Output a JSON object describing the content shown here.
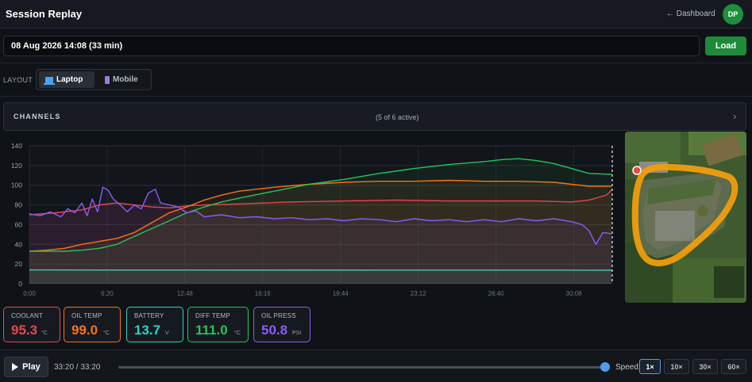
{
  "header": {
    "title": "Session Replay",
    "back_label": "← Dashboard",
    "avatar_initials": "DP"
  },
  "session": {
    "value": "08 Aug 2026 14:08 (33 min)",
    "load_label": "Load"
  },
  "layout": {
    "label": "LAYOUT",
    "options": [
      "Laptop",
      "Mobile"
    ],
    "selected": "Laptop"
  },
  "channels": {
    "title": "CHANNELS",
    "summary": "(5 of 6 active)"
  },
  "chart_data": {
    "type": "line",
    "yticks": [
      "0",
      "20",
      "40",
      "60",
      "80",
      "100",
      "120",
      "140"
    ],
    "xticks": [
      "0:00",
      "6:20",
      "12:48",
      "16:16",
      "19:44",
      "23:12",
      "26:40",
      "30:08"
    ],
    "ylim": [
      0,
      140
    ],
    "xlim_minutes": [
      0,
      33.33
    ],
    "grid": true,
    "series": [
      {
        "name": "COOLANT",
        "color": "#e5484d",
        "points": [
          [
            0,
            70
          ],
          [
            1.5,
            72
          ],
          [
            3,
            75
          ],
          [
            4,
            80
          ],
          [
            5,
            82
          ],
          [
            6,
            80
          ],
          [
            7,
            78
          ],
          [
            8,
            77
          ],
          [
            9,
            79
          ],
          [
            10,
            80
          ],
          [
            12,
            81
          ],
          [
            15,
            83
          ],
          [
            18,
            84
          ],
          [
            21,
            85
          ],
          [
            24,
            84
          ],
          [
            27,
            84
          ],
          [
            29,
            84
          ],
          [
            31,
            83
          ],
          [
            32,
            85
          ],
          [
            33,
            90
          ],
          [
            33.3,
            95.3
          ]
        ]
      },
      {
        "name": "OIL TEMP",
        "color": "#f97316",
        "points": [
          [
            0,
            33
          ],
          [
            1,
            34
          ],
          [
            2,
            36
          ],
          [
            3,
            40
          ],
          [
            4,
            43
          ],
          [
            5,
            46
          ],
          [
            6,
            52
          ],
          [
            7,
            62
          ],
          [
            8,
            72
          ],
          [
            9,
            78
          ],
          [
            10,
            85
          ],
          [
            11,
            90
          ],
          [
            12,
            94
          ],
          [
            14,
            98
          ],
          [
            16,
            101
          ],
          [
            18,
            103
          ],
          [
            20,
            104
          ],
          [
            22,
            104
          ],
          [
            24,
            105
          ],
          [
            26,
            104
          ],
          [
            28,
            104
          ],
          [
            30,
            103
          ],
          [
            31,
            101
          ],
          [
            32,
            99
          ],
          [
            33.3,
            99
          ]
        ]
      },
      {
        "name": "BATTERY",
        "color": "#2dd4bf",
        "points": [
          [
            0,
            14
          ],
          [
            10,
            13.9
          ],
          [
            20,
            13.8
          ],
          [
            30,
            13.8
          ],
          [
            33.3,
            13.7
          ]
        ]
      },
      {
        "name": "DIFF TEMP",
        "color": "#22c55e",
        "points": [
          [
            0,
            33
          ],
          [
            2,
            33
          ],
          [
            3,
            34
          ],
          [
            4,
            36
          ],
          [
            5,
            40
          ],
          [
            6,
            48
          ],
          [
            7,
            56
          ],
          [
            8,
            64
          ],
          [
            9,
            72
          ],
          [
            10,
            78
          ],
          [
            11,
            83
          ],
          [
            12,
            87
          ],
          [
            14,
            94
          ],
          [
            16,
            101
          ],
          [
            18,
            106
          ],
          [
            20,
            112
          ],
          [
            22,
            117
          ],
          [
            24,
            121
          ],
          [
            26,
            124
          ],
          [
            27,
            126
          ],
          [
            28,
            127
          ],
          [
            29,
            125
          ],
          [
            30,
            122
          ],
          [
            31,
            117
          ],
          [
            32,
            112
          ],
          [
            33.3,
            111
          ]
        ]
      },
      {
        "name": "OIL PRESS",
        "color": "#8b5cf6",
        "points": [
          [
            0,
            71
          ],
          [
            0.6,
            69
          ],
          [
            1.2,
            73
          ],
          [
            1.8,
            68
          ],
          [
            2.2,
            76
          ],
          [
            2.6,
            72
          ],
          [
            3,
            82
          ],
          [
            3.3,
            69
          ],
          [
            3.6,
            86
          ],
          [
            3.9,
            73
          ],
          [
            4.2,
            98
          ],
          [
            4.5,
            95
          ],
          [
            4.8,
            86
          ],
          [
            5.2,
            80
          ],
          [
            5.6,
            73
          ],
          [
            6,
            80
          ],
          [
            6.4,
            76
          ],
          [
            6.8,
            92
          ],
          [
            7.2,
            96
          ],
          [
            7.5,
            82
          ],
          [
            8,
            80
          ],
          [
            8.5,
            78
          ],
          [
            9,
            72
          ],
          [
            9.5,
            74
          ],
          [
            10,
            68
          ],
          [
            11,
            70
          ],
          [
            12,
            67
          ],
          [
            13,
            68
          ],
          [
            14,
            66
          ],
          [
            15,
            67
          ],
          [
            16,
            65
          ],
          [
            17,
            66
          ],
          [
            18,
            64
          ],
          [
            19,
            66
          ],
          [
            20,
            65
          ],
          [
            21,
            63
          ],
          [
            22,
            66
          ],
          [
            23,
            64
          ],
          [
            24,
            65
          ],
          [
            25,
            63
          ],
          [
            26,
            65
          ],
          [
            27,
            63
          ],
          [
            28,
            66
          ],
          [
            29,
            64
          ],
          [
            30,
            66
          ],
          [
            31,
            63
          ],
          [
            31.6,
            60
          ],
          [
            32,
            54
          ],
          [
            32.4,
            40
          ],
          [
            32.8,
            52
          ],
          [
            33.3,
            50.8
          ]
        ]
      }
    ]
  },
  "metrics": [
    {
      "label": "COOLANT",
      "value": "95.3",
      "unit": "°C",
      "color": "#e5484d"
    },
    {
      "label": "OIL TEMP",
      "value": "99.0",
      "unit": "°C",
      "color": "#f97316"
    },
    {
      "label": "BATTERY",
      "value": "13.7",
      "unit": "V",
      "color": "#2dd4bf"
    },
    {
      "label": "DIFF TEMP",
      "value": "111.0",
      "unit": "°C",
      "color": "#22c55e"
    },
    {
      "label": "OIL PRESS",
      "value": "50.8",
      "unit": "PSI",
      "color": "#8b5cf6"
    }
  ],
  "playback": {
    "play_label": "Play",
    "time": "33:20 / 33:20",
    "progress": 1.0,
    "speed_label": "Speed:",
    "speeds": [
      "1×",
      "10×",
      "30×",
      "60×"
    ],
    "selected_speed": "1×"
  },
  "map": {
    "track_color": "#f59e0b",
    "marker_color": "#ef4444"
  }
}
